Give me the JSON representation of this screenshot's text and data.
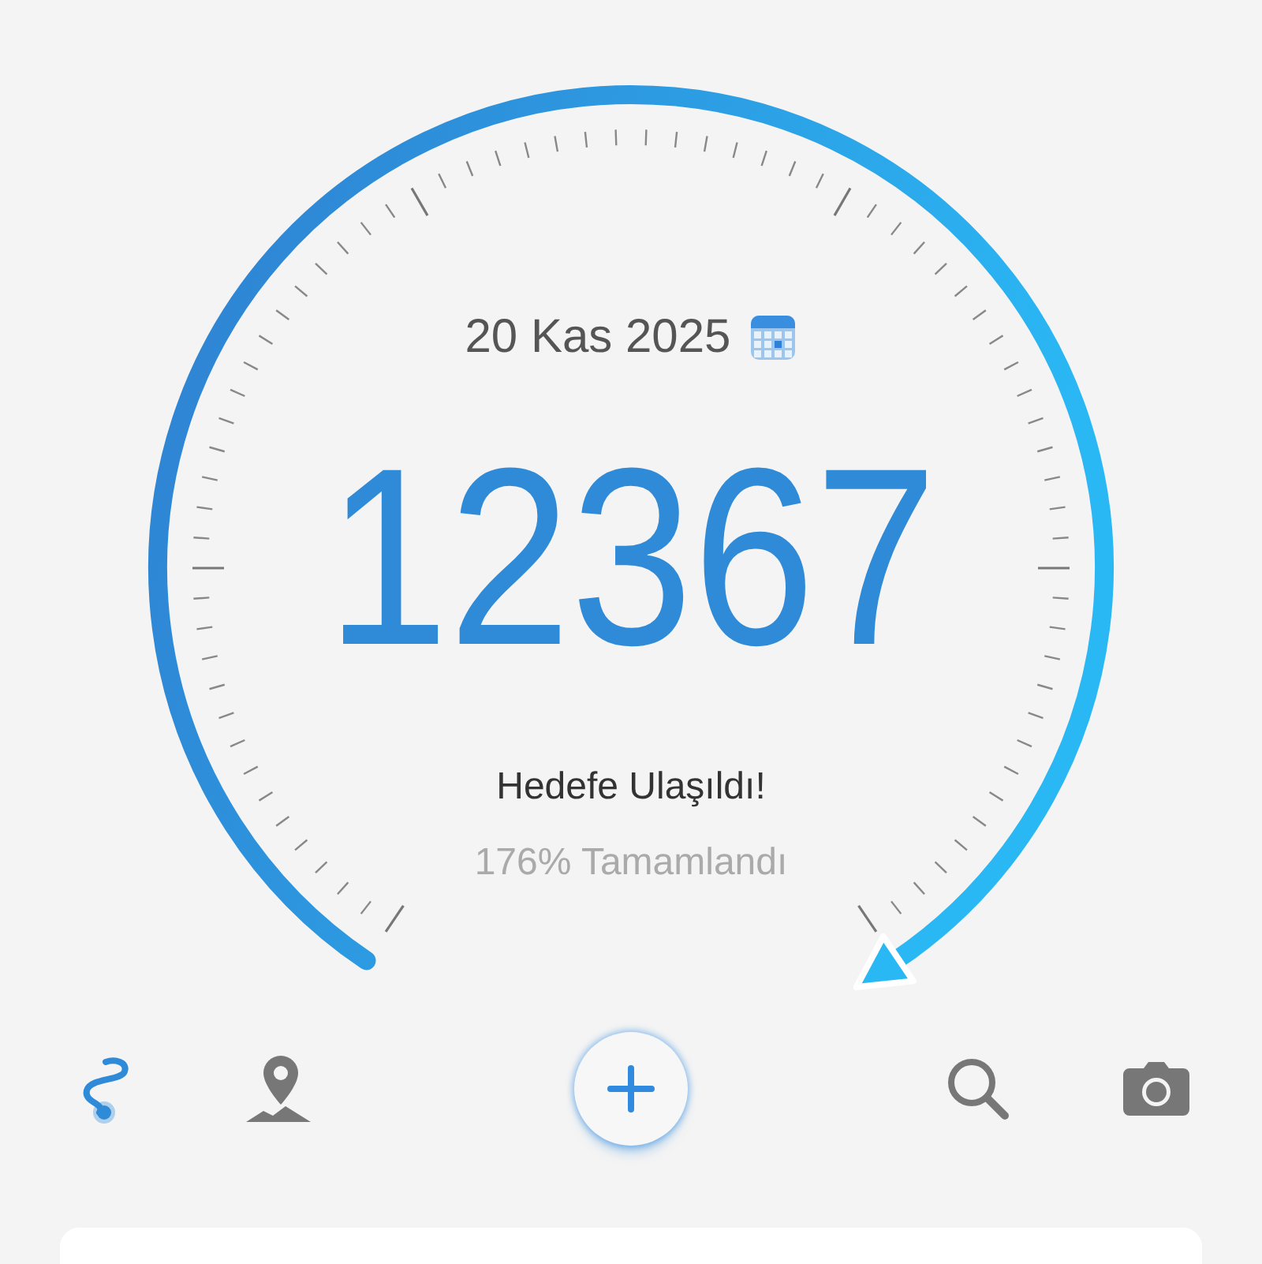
{
  "gauge": {
    "date": "20 Kas 2025",
    "steps": "12367",
    "goal_status": "Hedefe Ulaşıldı!",
    "progress_text": "176% Tamamlandı"
  },
  "nav": [
    {
      "kind": "route",
      "selected": true
    },
    {
      "kind": "map",
      "selected": false
    },
    {
      "kind": "add",
      "selected": false
    },
    {
      "kind": "search",
      "selected": false
    },
    {
      "kind": "camera",
      "selected": false
    }
  ]
}
